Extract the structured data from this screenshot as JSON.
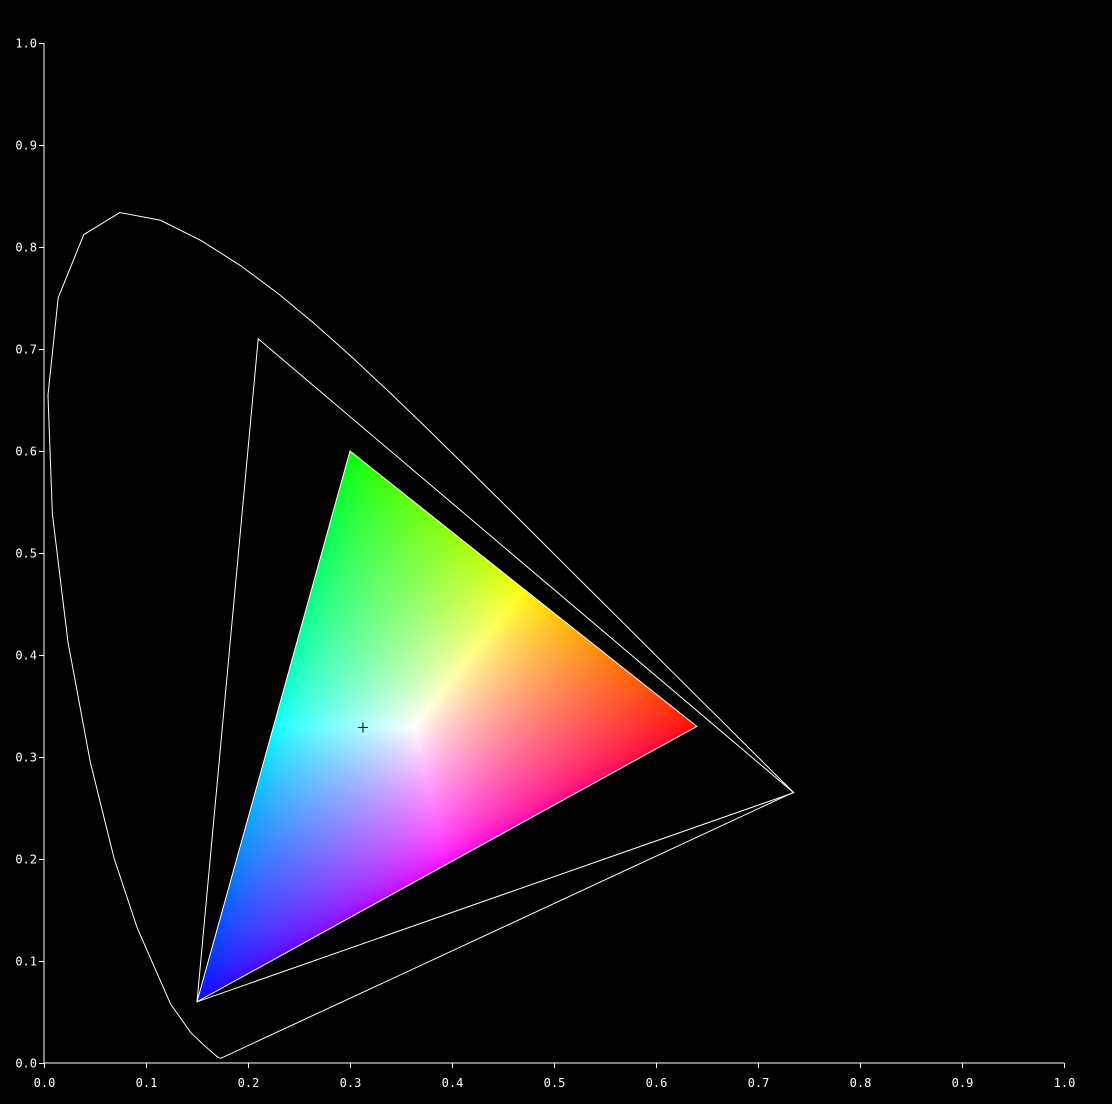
{
  "chart_data": {
    "type": "scatter",
    "title": "",
    "xlabel": "",
    "ylabel": "",
    "xlim": [
      0.0,
      1.0
    ],
    "ylim": [
      0.0,
      1.0
    ],
    "grid": false,
    "x_ticks": [
      "0.0",
      "0.1",
      "0.2",
      "0.3",
      "0.4",
      "0.5",
      "0.6",
      "0.7",
      "0.8",
      "0.9",
      "1.0"
    ],
    "y_ticks": [
      "0.0",
      "0.1",
      "0.2",
      "0.3",
      "0.4",
      "0.5",
      "0.6",
      "0.7",
      "0.8",
      "0.9",
      "1.0"
    ],
    "spectral_locus": [
      [
        0.1741,
        0.005
      ],
      [
        0.1738,
        0.0049
      ],
      [
        0.1733,
        0.0048
      ],
      [
        0.1726,
        0.0048
      ],
      [
        0.1714,
        0.0051
      ],
      [
        0.1689,
        0.0069
      ],
      [
        0.1644,
        0.0109
      ],
      [
        0.1566,
        0.0177
      ],
      [
        0.144,
        0.0297
      ],
      [
        0.1241,
        0.0578
      ],
      [
        0.0913,
        0.1327
      ],
      [
        0.0687,
        0.2007
      ],
      [
        0.0454,
        0.295
      ],
      [
        0.0235,
        0.4127
      ],
      [
        0.0082,
        0.5384
      ],
      [
        0.0039,
        0.6548
      ],
      [
        0.0139,
        0.7502
      ],
      [
        0.0389,
        0.812
      ],
      [
        0.0743,
        0.8338
      ],
      [
        0.1142,
        0.8262
      ],
      [
        0.1547,
        0.8059
      ],
      [
        0.1929,
        0.7816
      ],
      [
        0.2296,
        0.7543
      ],
      [
        0.2658,
        0.7243
      ],
      [
        0.3016,
        0.6923
      ],
      [
        0.3373,
        0.6589
      ],
      [
        0.3731,
        0.6245
      ],
      [
        0.4087,
        0.5896
      ],
      [
        0.4441,
        0.5547
      ],
      [
        0.4788,
        0.5202
      ],
      [
        0.5125,
        0.4866
      ],
      [
        0.5448,
        0.4544
      ],
      [
        0.5752,
        0.4242
      ],
      [
        0.6029,
        0.3965
      ],
      [
        0.627,
        0.3725
      ],
      [
        0.6482,
        0.3514
      ],
      [
        0.6658,
        0.334
      ],
      [
        0.6801,
        0.3197
      ],
      [
        0.6915,
        0.3083
      ],
      [
        0.7006,
        0.2993
      ],
      [
        0.7079,
        0.292
      ],
      [
        0.714,
        0.2859
      ],
      [
        0.719,
        0.2809
      ],
      [
        0.723,
        0.277
      ],
      [
        0.726,
        0.274
      ],
      [
        0.7283,
        0.2717
      ],
      [
        0.73,
        0.27
      ],
      [
        0.7311,
        0.2689
      ],
      [
        0.732,
        0.268
      ],
      [
        0.7327,
        0.2673
      ],
      [
        0.7334,
        0.2666
      ],
      [
        0.734,
        0.266
      ],
      [
        0.7344,
        0.2656
      ],
      [
        0.7346,
        0.2654
      ],
      [
        0.7347,
        0.2653
      ]
    ],
    "wide_gamut_triangle": [
      [
        0.735,
        0.265
      ],
      [
        0.21,
        0.71
      ],
      [
        0.15,
        0.06
      ]
    ],
    "srgb_triangle": {
      "red": [
        0.64,
        0.33
      ],
      "green": [
        0.3,
        0.6
      ],
      "blue": [
        0.15,
        0.06
      ]
    },
    "white_point": [
      0.3127,
      0.329
    ],
    "colors": {
      "background": "#000000",
      "lines": "#ffffff",
      "white_point_marker": "#000000",
      "red_primary": "#ff0000",
      "green_primary": "#00ff00",
      "blue_primary": "#0000ff"
    }
  }
}
